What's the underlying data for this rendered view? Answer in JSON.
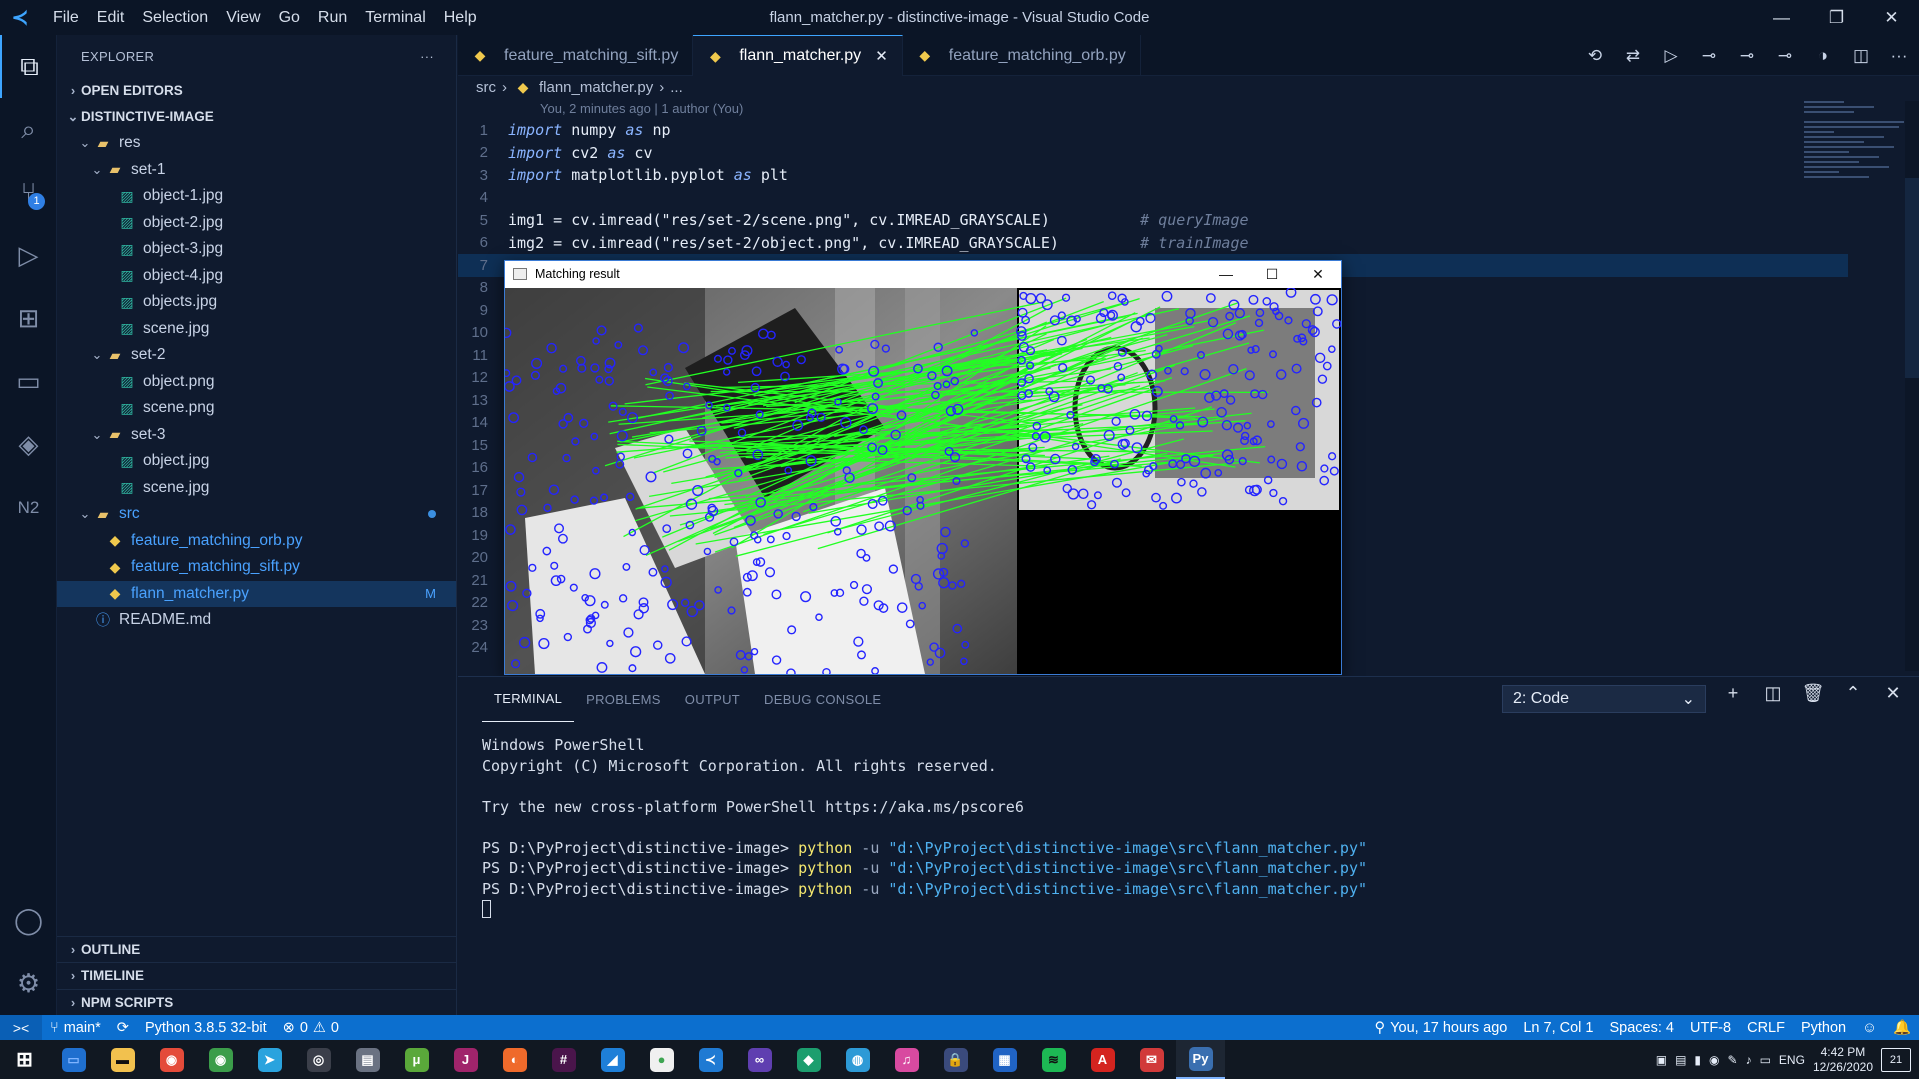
{
  "window": {
    "title": "flann_matcher.py - distinctive-image - Visual Studio Code",
    "logo": "vscode-logo",
    "menu": [
      "File",
      "Edit",
      "Selection",
      "View",
      "Go",
      "Run",
      "Terminal",
      "Help"
    ],
    "controls": [
      "minimize",
      "restore",
      "close"
    ]
  },
  "activity_bar": {
    "items": [
      {
        "name": "explorer-icon",
        "glyph": "⧉"
      },
      {
        "name": "search-icon",
        "glyph": "⌕"
      },
      {
        "name": "source-control-icon",
        "glyph": "⑂",
        "badge": "1"
      },
      {
        "name": "run-debug-icon",
        "glyph": "▷"
      },
      {
        "name": "extensions-icon",
        "glyph": "⊞"
      },
      {
        "name": "remote-explorer-icon",
        "glyph": "▭"
      },
      {
        "name": "gitlens-icon",
        "glyph": "◈"
      },
      {
        "name": "n2-icon",
        "glyph": "N2"
      }
    ],
    "bottom": [
      {
        "name": "account-icon",
        "glyph": "◯"
      },
      {
        "name": "settings-gear-icon",
        "glyph": "⚙"
      }
    ]
  },
  "explorer": {
    "header": "EXPLORER",
    "more": "···",
    "open_editors": "OPEN EDITORS",
    "project": "DISTINCTIVE-IMAGE",
    "tree": [
      {
        "label": "res",
        "depth": 1,
        "kind": "folder",
        "open": true
      },
      {
        "label": "set-1",
        "depth": 2,
        "kind": "folder",
        "open": true
      },
      {
        "label": "object-1.jpg",
        "depth": 3,
        "kind": "image"
      },
      {
        "label": "object-2.jpg",
        "depth": 3,
        "kind": "image"
      },
      {
        "label": "object-3.jpg",
        "depth": 3,
        "kind": "image"
      },
      {
        "label": "object-4.jpg",
        "depth": 3,
        "kind": "image"
      },
      {
        "label": "objects.jpg",
        "depth": 3,
        "kind": "image"
      },
      {
        "label": "scene.jpg",
        "depth": 3,
        "kind": "image"
      },
      {
        "label": "set-2",
        "depth": 2,
        "kind": "folder",
        "open": true
      },
      {
        "label": "object.png",
        "depth": 3,
        "kind": "image"
      },
      {
        "label": "scene.png",
        "depth": 3,
        "kind": "image"
      },
      {
        "label": "set-3",
        "depth": 2,
        "kind": "folder",
        "open": true
      },
      {
        "label": "object.jpg",
        "depth": 3,
        "kind": "image"
      },
      {
        "label": "scene.jpg",
        "depth": 3,
        "kind": "image"
      },
      {
        "label": "src",
        "depth": 1,
        "kind": "folder",
        "open": true,
        "dot": true,
        "color": "#4aa2ff"
      },
      {
        "label": "feature_matching_orb.py",
        "depth": 2,
        "kind": "python",
        "color": "#4aa2ff"
      },
      {
        "label": "feature_matching_sift.py",
        "depth": 2,
        "kind": "python",
        "color": "#4aa2ff"
      },
      {
        "label": "flann_matcher.py",
        "depth": 2,
        "kind": "python",
        "selected": true,
        "mark": "M",
        "color": "#4aa2ff"
      },
      {
        "label": "README.md",
        "depth": 1,
        "kind": "info"
      }
    ],
    "bottom_sections": [
      "OUTLINE",
      "TIMELINE",
      "NPM SCRIPTS"
    ]
  },
  "editor": {
    "tabs": [
      {
        "label": "feature_matching_sift.py",
        "active": false
      },
      {
        "label": "flann_matcher.py",
        "active": true,
        "close": "✕"
      },
      {
        "label": "feature_matching_orb.py",
        "active": false
      }
    ],
    "tab_actions": [
      "history-icon",
      "compare-icon",
      "run-icon",
      "git-commit-icon",
      "previous-change-icon",
      "next-change-icon",
      "gitlens-toggle-icon",
      "split-editor-icon",
      "more-actions-icon"
    ],
    "breadcrumb": [
      "src",
      "flann_matcher.py",
      "..."
    ],
    "blame": "You, 2 minutes ago | 1 author (You)",
    "lines": [
      {
        "n": "1",
        "code": [
          [
            "kw",
            "import"
          ],
          [
            "tx",
            " numpy "
          ],
          [
            "kw",
            "as"
          ],
          [
            "tx",
            " np"
          ]
        ]
      },
      {
        "n": "2",
        "code": [
          [
            "kw",
            "import"
          ],
          [
            "tx",
            " cv2 "
          ],
          [
            "kw",
            "as"
          ],
          [
            "tx",
            " cv"
          ]
        ]
      },
      {
        "n": "3",
        "code": [
          [
            "kw",
            "import"
          ],
          [
            "tx",
            " matplotlib.pyplot "
          ],
          [
            "kw",
            "as"
          ],
          [
            "tx",
            " plt"
          ]
        ]
      },
      {
        "n": "4",
        "code": []
      },
      {
        "n": "5",
        "code": [
          [
            "tx",
            "img1 = cv.imread(\"res/set-2/scene.png\", cv.IMREAD_GRAYSCALE)          "
          ],
          [
            "cm",
            "# queryImage"
          ]
        ]
      },
      {
        "n": "6",
        "code": [
          [
            "tx",
            "img2 = cv.imread(\"res/set-2/object.png\", cv.IMREAD_GRAYSCALE)         "
          ],
          [
            "cm",
            "# trainImage"
          ]
        ]
      },
      {
        "n": "7",
        "code": [],
        "hl": true
      },
      {
        "n": "8",
        "code": []
      },
      {
        "n": "9",
        "code": []
      },
      {
        "n": "10",
        "code": []
      },
      {
        "n": "11",
        "code": []
      },
      {
        "n": "12",
        "code": []
      },
      {
        "n": "13",
        "code": []
      },
      {
        "n": "14",
        "code": []
      },
      {
        "n": "15",
        "code": []
      },
      {
        "n": "16",
        "code": []
      },
      {
        "n": "17",
        "code": []
      },
      {
        "n": "18",
        "code": []
      },
      {
        "n": "19",
        "code": []
      },
      {
        "n": "20",
        "code": []
      },
      {
        "n": "21",
        "code": []
      },
      {
        "n": "22",
        "code": []
      },
      {
        "n": "23",
        "code": []
      },
      {
        "n": "24",
        "code": []
      }
    ]
  },
  "cv_window": {
    "title": "Matching result",
    "controls": [
      "minimize",
      "maximize",
      "close"
    ]
  },
  "panel": {
    "tabs": [
      "TERMINAL",
      "PROBLEMS",
      "OUTPUT",
      "DEBUG CONSOLE"
    ],
    "active_tab": "TERMINAL",
    "terminal_select": "2: Code",
    "actions": [
      "new-terminal-icon",
      "split-terminal-icon",
      "kill-terminal-icon",
      "maximize-panel-icon",
      "close-panel-icon"
    ],
    "terminal": {
      "banner": [
        "Windows PowerShell",
        "Copyright (C) Microsoft Corporation. All rights reserved.",
        "",
        "Try the new cross-platform PowerShell https://aka.ms/pscore6",
        ""
      ],
      "prompt": "PS D:\\PyProject\\distinctive-image> ",
      "command": "python",
      "flag": " -u ",
      "path": "\"d:\\PyProject\\distinctive-image\\src\\flann_matcher.py\"",
      "runs": 3
    }
  },
  "statusbar": {
    "remote": "><",
    "branch": "main*",
    "sync": "⟳",
    "interpreter": "Python 3.8.5 32-bit",
    "errors": "0",
    "warnings": "0",
    "blame": "You, 17 hours ago",
    "position": "Ln 7, Col 1",
    "spaces": "Spaces: 4",
    "encoding": "UTF-8",
    "eol": "CRLF",
    "language": "Python",
    "feedback": "☺",
    "bell": "🔔"
  },
  "taskbar": {
    "apps": [
      {
        "name": "start-icon",
        "glyph": "⊞",
        "color": "#ffffff",
        "bg": "transparent"
      },
      {
        "name": "task-view-icon",
        "glyph": "▭",
        "color": "#7fb4ff",
        "bg": "#1f6fcf"
      },
      {
        "name": "file-explorer-icon",
        "glyph": "▬",
        "color": "#111",
        "bg": "#f2c14e"
      },
      {
        "name": "chrome-icon",
        "glyph": "◉",
        "color": "#fff",
        "bg": "#e44b3a"
      },
      {
        "name": "chrome-profile-icon",
        "glyph": "◉",
        "color": "#fff",
        "bg": "#3b9d4a"
      },
      {
        "name": "telegram-icon",
        "glyph": "➤",
        "color": "#fff",
        "bg": "#2aa3de"
      },
      {
        "name": "obs-icon",
        "glyph": "◎",
        "color": "#fff",
        "bg": "#3b3f4a"
      },
      {
        "name": "network-drive-icon",
        "glyph": "▤",
        "color": "#fff",
        "bg": "#6a7282"
      },
      {
        "name": "utorrent-icon",
        "glyph": "μ",
        "color": "#fff",
        "bg": "#5aa83a"
      },
      {
        "name": "jetbrains-icon",
        "glyph": "J",
        "color": "#fff",
        "bg": "#a0246b"
      },
      {
        "name": "postman-icon",
        "glyph": "◐",
        "color": "#fff",
        "bg": "#ef6a2b"
      },
      {
        "name": "slack-icon",
        "glyph": "#",
        "color": "#fff",
        "bg": "#4a154b"
      },
      {
        "name": "azure-data-studio-icon",
        "glyph": "◢",
        "color": "#fff",
        "bg": "#1e7fd8"
      },
      {
        "name": "mongodb-compass-icon",
        "glyph": "●",
        "color": "#3ea552",
        "bg": "#f0f0f0"
      },
      {
        "name": "vscode-taskbar-icon",
        "glyph": "≺",
        "color": "#fff",
        "bg": "#1f7ad3"
      },
      {
        "name": "visual-studio-icon",
        "glyph": "∞",
        "color": "#fff",
        "bg": "#5f3fb0"
      },
      {
        "name": "gitkraken-icon",
        "glyph": "◆",
        "color": "#fff",
        "bg": "#1c9e6e"
      },
      {
        "name": "world-icon",
        "glyph": "◍",
        "color": "#fff",
        "bg": "#2d9ad6"
      },
      {
        "name": "itunes-icon",
        "glyph": "♫",
        "color": "#fff",
        "bg": "#d84aa0"
      },
      {
        "name": "vpn-icon",
        "glyph": "🔒",
        "color": "#fff",
        "bg": "#3a4a7c"
      },
      {
        "name": "calendar-icon",
        "glyph": "▦",
        "color": "#fff",
        "bg": "#2063c4"
      },
      {
        "name": "spotify-icon",
        "glyph": "≋",
        "color": "#111",
        "bg": "#1db954"
      },
      {
        "name": "acrobat-icon",
        "glyph": "A",
        "color": "#fff",
        "bg": "#d4241f"
      },
      {
        "name": "chat-icon",
        "glyph": "✉",
        "color": "#fff",
        "bg": "#d13a3a"
      },
      {
        "name": "python-window-icon",
        "glyph": "Py",
        "color": "#fff",
        "bg": "#3a6fb0",
        "active": true
      }
    ],
    "tray_icons": [
      "nvidia-icon",
      "network-share-icon",
      "battery-icon",
      "chrome-tray-icon",
      "pen-icon",
      "volume-icon",
      "network-icon"
    ],
    "language": "ENG",
    "time": "4:42 PM",
    "date": "12/26/2020",
    "notifications": "21"
  }
}
